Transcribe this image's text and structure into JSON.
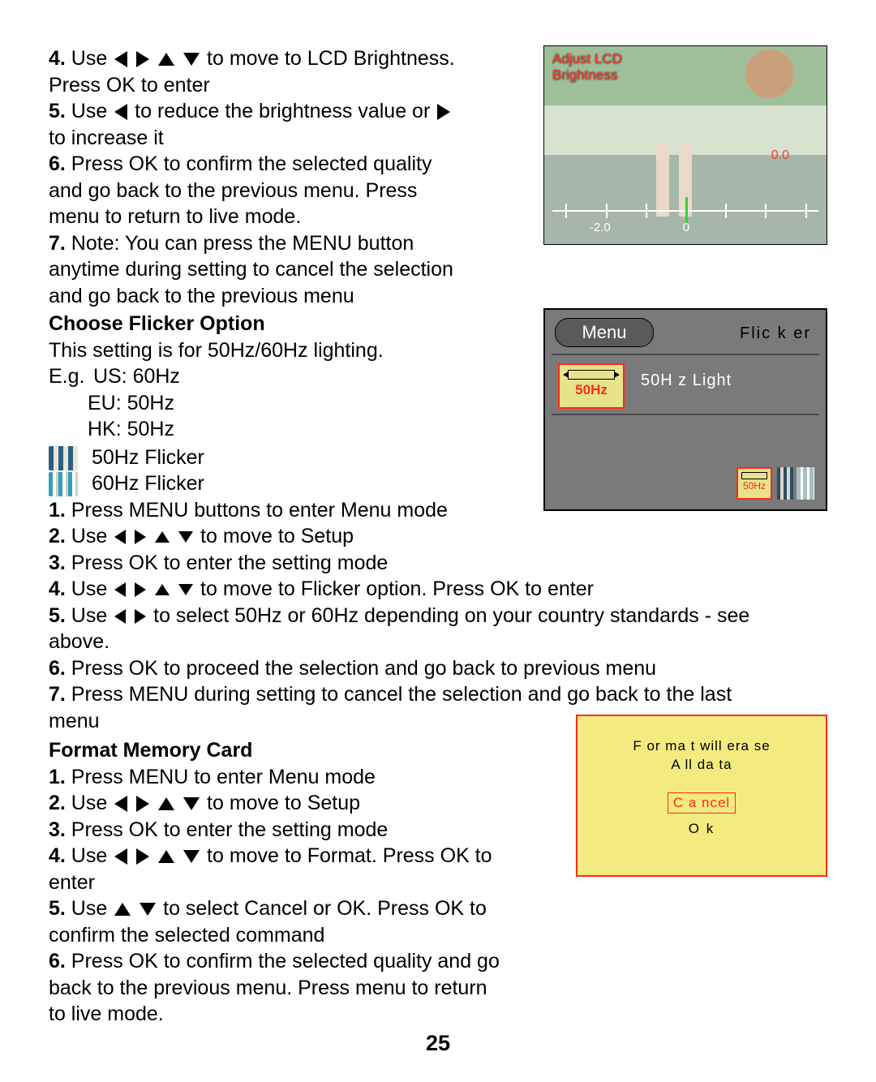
{
  "page_number": "25",
  "sec_bright": {
    "s4_a": "4.",
    "s4_b": " Use ",
    "s4_c": " to move to LCD Brightness. Press OK to enter",
    "s5_a": "5.",
    "s5_b": " Use ",
    "s5_c": " to reduce the brightness value or",
    "s5_d": " to increase it",
    "s6_a": "6.",
    "s6_b": " Press OK to confirm the selected quality and go back to the previous menu. Press menu to return to live mode.",
    "s7_a": "7.",
    "s7_b": " Note: You can press the MENU button anytime during setting to cancel the selection and go back to the previous menu"
  },
  "sec_flicker": {
    "heading": "Choose Flicker Option",
    "intro": "This setting is for 50Hz/60Hz lighting.",
    "eg_label": "E.g.",
    "eg_us": "US: 60Hz",
    "eg_eu": "EU: 50Hz",
    "eg_hk": "HK: 50Hz",
    "icon50_label": "50Hz Flicker",
    "icon60_label": "60Hz Flicker",
    "s1_a": "1.",
    "s1_b": " Press MENU buttons to enter Menu mode",
    "s2_a": "2.",
    "s2_b": " Use ",
    "s2_c": " to move to Setup",
    "s3_a": "3.",
    "s3_b": " Press OK to enter the setting mode",
    "s4_a": "4.",
    "s4_b": " Use ",
    "s4_c": " to move to Flicker option. Press OK to enter",
    "s5_a": "5.",
    "s5_b": " Use ",
    "s5_c": " to select 50Hz or 60Hz depending on your country standards - see above.",
    "s6_a": "6.",
    "s6_b": " Press OK to proceed the selection and go back to previous menu",
    "s7_a": "7.",
    "s7_b": " Press MENU during setting to cancel the selection and go back to the last menu"
  },
  "sec_format": {
    "heading": "Format Memory Card",
    "s1_a": "1.",
    "s1_b": " Press MENU to enter Menu mode",
    "s2_a": "2.",
    "s2_b": " Use ",
    "s2_c": " to move to Setup",
    "s3_a": "3.",
    "s3_b": " Press OK to enter the setting mode",
    "s4_a": "4.",
    "s4_b": " Use ",
    "s4_c": " to move to Format.  Press OK to enter",
    "s5_a": "5.",
    "s5_b": " Use ",
    "s5_c": " to select Cancel or OK.  Press OK to confirm the selected command",
    "s6_a": "6.",
    "s6_b": " Press OK to confirm the selected quality and go back to the previous menu. Press menu to return to live mode."
  },
  "fig_bright": {
    "title_l1": "Adjust  LCD",
    "title_l2": "Brightness",
    "value": "0.0",
    "tick_neg": "-2.0",
    "tick_zero": "0"
  },
  "fig_flicker": {
    "menu": "Menu",
    "title": "Flic k er",
    "option_icon_label": "50Hz",
    "option_text": "50H z Light",
    "thumb_label": "50Hz"
  },
  "fig_format": {
    "line1": "F or ma t will  era se",
    "line2": "A ll  da ta",
    "cancel": "C a ncel",
    "ok": "O k"
  }
}
